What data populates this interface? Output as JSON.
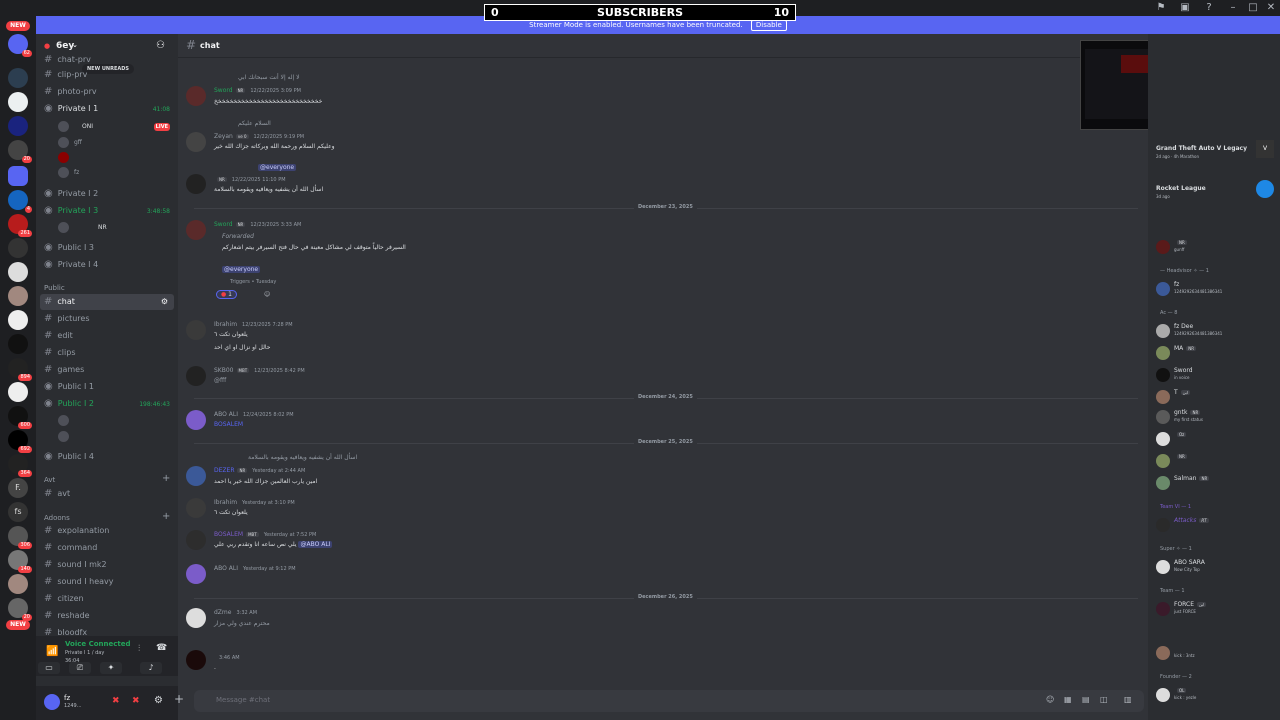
{
  "overlay": {
    "left_count": "0",
    "title": "SUBSCRIBERS",
    "right_count": "10"
  },
  "banner": {
    "text": "Streamer Mode is enabled. Usernames have been truncated.",
    "button": "Disable"
  },
  "rail": {
    "new_top": "NEW",
    "new_bottom": "NEW",
    "badges": [
      "62",
      "20",
      "4",
      "261",
      "894",
      "600",
      "692",
      "364",
      "306",
      "140",
      "20"
    ]
  },
  "server": {
    "name": "6ey",
    "new_unreads": "NEW UNREADS"
  },
  "channels": {
    "c1": "chat-prv",
    "c2": "clip-prv",
    "c3": "photo-prv",
    "private1": "Private  I 1",
    "private1_timer": "41:08",
    "vc1_user1": "ONI",
    "vc1_live": "LIVE",
    "vc1_user2": "gff",
    "vc1_user3": "",
    "vc1_user4": "fz",
    "private2": "Private  I 2",
    "private3": "Private  I 3",
    "private3_timer": "3:48:58",
    "vc3_user1": "NR",
    "public3": "Public  I 3",
    "private4": "Private  I 4",
    "cat_public": "Public",
    "chat": "chat",
    "pictures": "pictures",
    "edit": "edit",
    "clips": "clips",
    "games": "games",
    "public1": "Public  I 1",
    "public2": "Public  I 2",
    "public2_timer": "198:46:43",
    "public4": "Public  I 4",
    "cat_avt": "Avt",
    "avt": "avt",
    "cat_adoons": "Adoons",
    "expolanation": "expolanation",
    "command": "command",
    "sound_mk2": "sound  I mk2",
    "sound_heavy": "sound  I heavy",
    "citizen": "citizen",
    "reshade": "reshade",
    "bloodfx": "bloodfx"
  },
  "voice": {
    "status": "Voice Connected",
    "channel": "Private  I 1 / day",
    "time": "36:04"
  },
  "user": {
    "name": "fz",
    "tag": "1249..."
  },
  "chat": {
    "channel_name": "chat",
    "input_placeholder": "Message #chat",
    "dividers": [
      "December 23, 2025",
      "December 24, 2025",
      "December 25, 2025",
      "December 26, 2025"
    ],
    "messages": [
      {
        "name": "Sword",
        "tag": "NR",
        "time": "12/22/2025 3:09 PM",
        "text": "خخخخخخخخخخخخخخخخخخخخخخخخخخخخ",
        "reply": "لا إله إلا أنت سبحانك ابي"
      },
      {
        "name": "Zeyan",
        "tag": "ve 0",
        "time": "12/22/2025 9:19 PM",
        "text": "وعليكم السلام ورحمة الله وبركاته جزاك الله خير",
        "reply": "السلام عليكم"
      },
      {
        "name": "",
        "tag": "NR",
        "time": "12/22/2025 11:10 PM",
        "text": "اسأل الله أن يشفيه ويعافيه ويقومه بالسلامة",
        "mention": "@everyone"
      },
      {
        "name": "Sword",
        "tag": "NR",
        "time": "12/23/2025 3:33 AM",
        "forwarded": "Forwarded",
        "text": "السيرفر حالياً متوقف لي مشاكل معينة في حال فتح السيرفر بيتم اشعاركم",
        "mention": "@everyone",
        "footer": "Triggers • Tuesday",
        "reaction": "1"
      },
      {
        "name": "Ibrahim",
        "time": "12/23/2025 7:28 PM",
        "text": "يلعوان تكت ٦",
        "text2": "حالل او نزال او اي احد"
      },
      {
        "name": "SKB00",
        "tag": "MBT",
        "time": "12/23/2025 8:42 PM",
        "text": "@fff"
      },
      {
        "name": "ABO ALI",
        "time": "12/24/2025 8:02 PM",
        "text": "BOSALEM"
      },
      {
        "name": "DEZER",
        "tag": "NR",
        "time": "Yesterday at 2:44 AM",
        "text": "امين يارب العالمين جزاك الله خير يا احمد",
        "reply": "اسأل الله أن يشفيه ويعافيه ويقومه بالسلامة"
      },
      {
        "name": "Ibrahim",
        "time": "Yesterday at 3:10 PM",
        "text": "يلعوان تكت ٦"
      },
      {
        "name": "BOSALEM",
        "tag": "MBT",
        "time": "Yesterday at 7:52 PM",
        "text": "يلي نص ساعه انا وتقدم ربي علي",
        "mention": "@ABO ALI"
      },
      {
        "name": "ABO ALI",
        "time": "Yesterday at 9:12 PM",
        "text": ""
      },
      {
        "name": "dZme",
        "time": "3:32 AM",
        "text": "محترم عندي ولي مزار"
      },
      {
        "name": "",
        "time": "3:46 AM",
        "text": "."
      }
    ]
  },
  "members": {
    "groups": [
      "— Headvisor ✧ — 1",
      "Ac — 8",
      "Team VI — 1",
      "Super ✧ — 1",
      "Team — 1",
      "Founder — 2"
    ],
    "activity1": {
      "name": "Grand Theft Auto V Legacy",
      "sub": "2d ago · 4h Marathon"
    },
    "activity2": {
      "name": "Rocket League",
      "sub": "3d ago"
    },
    "list": [
      {
        "name": "",
        "tag": "NR",
        "status": "gunff"
      },
      {
        "name": "fz",
        "status": "1249292634481386341"
      },
      {
        "name": "fz Dee",
        "status": "1249292634481386341"
      },
      {
        "name": "MA",
        "tag": "NR",
        "status": ""
      },
      {
        "name": "Sword",
        "status": "in voice"
      },
      {
        "name": "T",
        "tag": "ابن",
        "status": ""
      },
      {
        "name": "gntk",
        "tag": "NR",
        "status": "my first status"
      },
      {
        "name": "",
        "tag": "Oz",
        "status": ""
      },
      {
        "name": "",
        "tag": "NR",
        "status": ""
      },
      {
        "name": "Salman",
        "tag": "NR",
        "status": ""
      },
      {
        "name": "Attacks",
        "tag": "RT",
        "status": ""
      },
      {
        "name": "ABO SARA",
        "status": "Now City Top"
      },
      {
        "name": "FORCE",
        "tag": "ابن",
        "status": "just FORCE"
      },
      {
        "name": "",
        "status": "kick : 3ntz"
      },
      {
        "name": "",
        "tag": "OL",
        "status": "kick : yezle"
      }
    ]
  }
}
